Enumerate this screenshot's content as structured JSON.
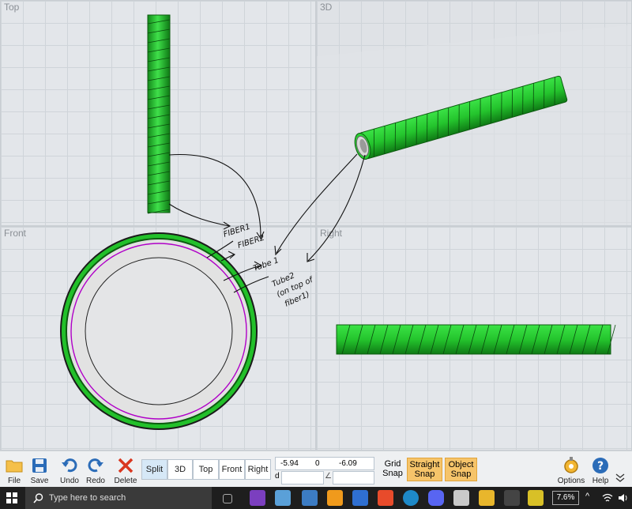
{
  "viewports": {
    "top": "Top",
    "3d": "3D",
    "front": "Front",
    "right": "Right"
  },
  "annotations": {
    "fiber1": "FIBER1",
    "fiber2": "FIBER2",
    "tube1": "Tube 1",
    "tube2_line1": "Tube2",
    "tube2_line2": "(on top of",
    "tube2_line3": "fiber1)"
  },
  "toolbar": {
    "file": "File",
    "save": "Save",
    "undo": "Undo",
    "redo": "Redo",
    "delete": "Delete",
    "views": [
      "Split",
      "3D",
      "Top",
      "Front",
      "Right"
    ],
    "active_view": "Split",
    "coord_x": "-5.94",
    "coord_y": "0",
    "coord_z": "-6.09",
    "d_label": "d",
    "angle_symbol": "∠",
    "grid_snap_1": "Grid",
    "grid_snap_2": "Snap",
    "straight_snap_1": "Straight",
    "straight_snap_2": "Snap",
    "object_snap_1": "Object",
    "object_snap_2": "Snap",
    "options": "Options",
    "help": "Help"
  },
  "taskbar": {
    "search_placeholder": "Type here to search",
    "cpu_label": "7.6%"
  },
  "colors": {
    "fiber_green": "#22c02a",
    "fiber_dark": "#0d6e12",
    "tube_magenta": "#b000c8",
    "snap_active": "#f6c46a"
  }
}
